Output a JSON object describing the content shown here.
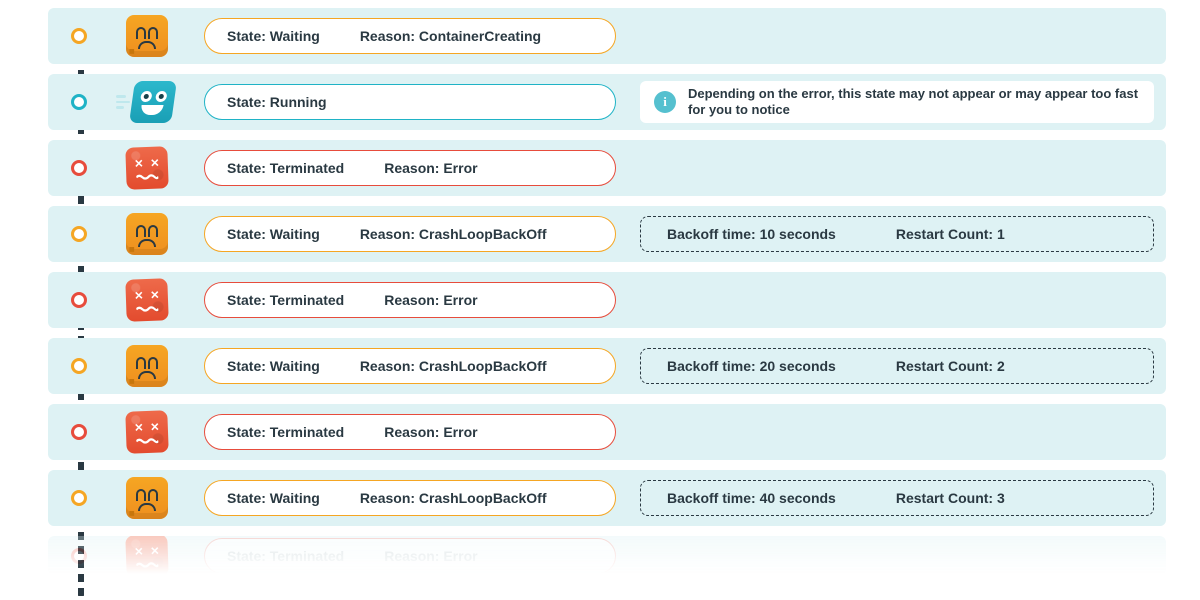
{
  "colors": {
    "waiting": "#F5A623",
    "running": "#1fb3c6",
    "terminated": "#e74c3c"
  },
  "rows": [
    {
      "variant": "waiting",
      "icon": "worried-container-icon",
      "state_text": "State: Waiting",
      "reason_text": "Reason: ContainerCreating"
    },
    {
      "variant": "running",
      "icon": "happy-container-icon",
      "state_text": "State: Running",
      "aside_note": "Depending on the error, this state may not appear or may appear too fast for you to notice"
    },
    {
      "variant": "terminated",
      "icon": "dead-container-icon",
      "state_text": "State: Terminated",
      "reason_text": "Reason: Error"
    },
    {
      "variant": "waiting",
      "icon": "worried-container-icon",
      "state_text": "State: Waiting",
      "reason_text": "Reason: CrashLoopBackOff",
      "backoff_text": "Backoff time: 10 seconds",
      "restart_text": "Restart Count: 1"
    },
    {
      "variant": "terminated",
      "icon": "dead-container-icon",
      "state_text": "State: Terminated",
      "reason_text": "Reason: Error"
    },
    {
      "variant": "waiting",
      "icon": "worried-container-icon",
      "state_text": "State: Waiting",
      "reason_text": "Reason: CrashLoopBackOff",
      "backoff_text": "Backoff time: 20 seconds",
      "restart_text": "Restart Count: 2"
    },
    {
      "variant": "terminated",
      "icon": "dead-container-icon",
      "state_text": "State: Terminated",
      "reason_text": "Reason: Error"
    },
    {
      "variant": "waiting",
      "icon": "worried-container-icon",
      "state_text": "State: Waiting",
      "reason_text": "Reason: CrashLoopBackOff",
      "backoff_text": "Backoff time: 40 seconds",
      "restart_text": "Restart Count: 3"
    },
    {
      "variant": "terminated",
      "icon": "dead-container-icon",
      "state_text": "State: Terminated",
      "reason_text": "Reason: Error",
      "faded": true
    }
  ]
}
